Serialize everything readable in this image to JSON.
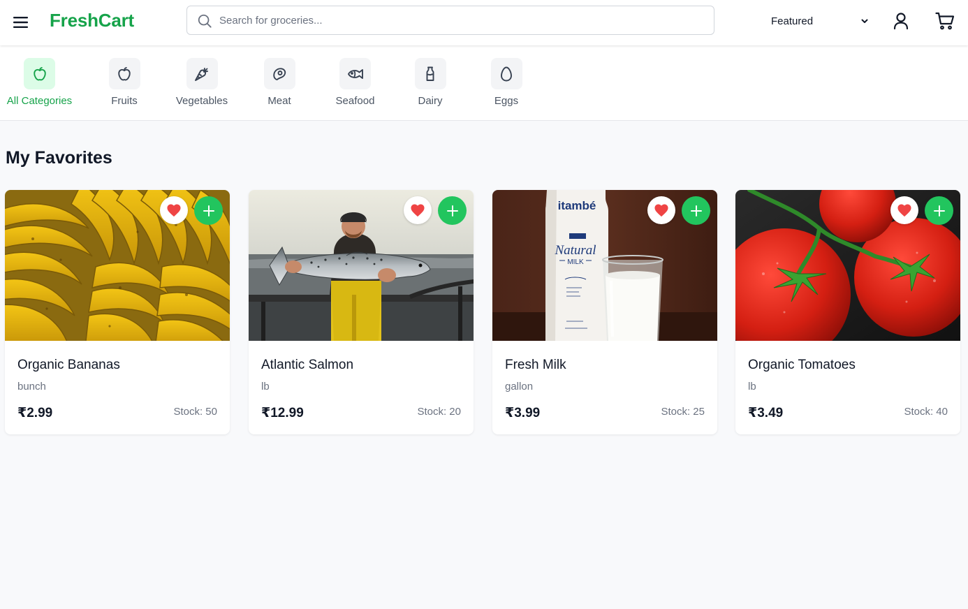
{
  "header": {
    "logo": "FreshCart",
    "search_placeholder": "Search for groceries...",
    "sort_selected": "Featured",
    "icons": [
      "menu-icon",
      "search-icon",
      "chevron-down-icon",
      "user-icon",
      "cart-icon"
    ]
  },
  "categories": [
    {
      "label": "All Categories",
      "icon": "apple-icon",
      "active": true
    },
    {
      "label": "Fruits",
      "icon": "apple-icon",
      "active": false
    },
    {
      "label": "Vegetables",
      "icon": "carrot-icon",
      "active": false
    },
    {
      "label": "Meat",
      "icon": "beef-icon",
      "active": false
    },
    {
      "label": "Seafood",
      "icon": "fish-icon",
      "active": false
    },
    {
      "label": "Dairy",
      "icon": "milk-icon",
      "active": false
    },
    {
      "label": "Eggs",
      "icon": "egg-icon",
      "active": false
    }
  ],
  "section": {
    "title": "My Favorites"
  },
  "products": [
    {
      "name": "Organic Bananas",
      "unit": "bunch",
      "price": "₹2.99",
      "stock": "Stock: 50",
      "image": "bananas photo",
      "favorited": true
    },
    {
      "name": "Atlantic Salmon",
      "unit": "lb",
      "price": "₹12.99",
      "stock": "Stock: 20",
      "image": "fisherman holding salmon photo",
      "favorited": true
    },
    {
      "name": "Fresh Milk",
      "unit": "gallon",
      "price": "₹3.99",
      "stock": "Stock: 25",
      "image": "milk carton and glass photo",
      "image_text": {
        "brand": "itambé",
        "product": "Natural",
        "sub": "MILK"
      },
      "favorited": true
    },
    {
      "name": "Organic Tomatoes",
      "unit": "lb",
      "price": "₹3.49",
      "stock": "Stock: 40",
      "image": "tomatoes on vine photo",
      "favorited": true
    }
  ],
  "colors": {
    "brand": "#16a34a",
    "add_button": "#22c55e",
    "heart": "#ef4444",
    "active_category_bg": "#dcfce7",
    "page_bg": "#f8f9fb"
  }
}
